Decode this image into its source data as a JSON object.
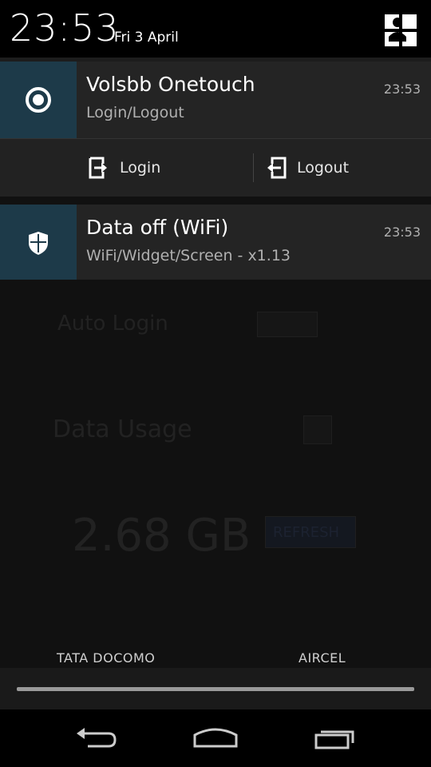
{
  "status": {
    "time": "23:53",
    "date": "Fri 3 April"
  },
  "notifications": [
    {
      "title": "Volsbb Onetouch",
      "subtitle": "Login/Logout",
      "time": "23:53",
      "icon": "radio-button-icon",
      "actions": [
        {
          "label": "Login",
          "icon": "login-icon"
        },
        {
          "label": "Logout",
          "icon": "logout-icon"
        }
      ]
    },
    {
      "title": "Data off (WiFi)",
      "subtitle": "WiFi/Widget/Screen - x1.13",
      "time": "23:53",
      "icon": "shield-icon"
    }
  ],
  "background_app": {
    "auto_login_label": "Auto Login",
    "data_usage_label": "Data Usage",
    "usage_value": "2.68 GB",
    "refresh_label": "REFRESH"
  },
  "carriers": [
    "TATA DOCOMO",
    "AIRCEL"
  ],
  "colors": {
    "icon_bg": "#1d3a49",
    "notif_bg": "#242424"
  }
}
